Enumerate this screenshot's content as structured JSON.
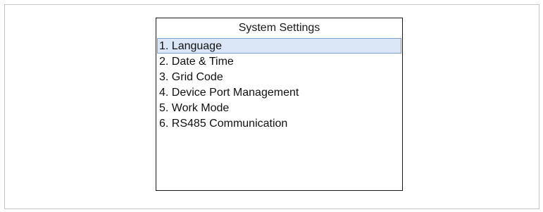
{
  "screen": {
    "title": "System Settings",
    "selected_index": 0,
    "menu_items": [
      {
        "label": "1. Language"
      },
      {
        "label": "2. Date & Time"
      },
      {
        "label": "3. Grid Code"
      },
      {
        "label": "4. Device Port Management"
      },
      {
        "label": "5. Work Mode"
      },
      {
        "label": "6. RS485 Communication"
      }
    ]
  },
  "colors": {
    "selected_background": "#dbe6f6",
    "selected_border": "#7a9cc8"
  }
}
